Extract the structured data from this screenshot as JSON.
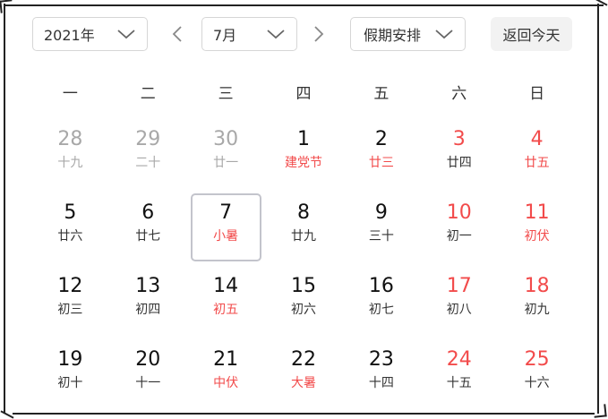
{
  "toolbar": {
    "year_value": "2021年",
    "month_value": "7月",
    "holiday_value": "假期安排",
    "today_label": "返回今天"
  },
  "weekdays": [
    "一",
    "二",
    "三",
    "四",
    "五",
    "六",
    "日"
  ],
  "colors": {
    "accent_red": "#f24b4b",
    "muted": "#a8a8a8",
    "selected_border": "#c3c4cc"
  },
  "icons": {
    "prev": "chevron-left-icon",
    "next": "chevron-right-icon",
    "dropdown": "chevron-down-icon"
  },
  "days": [
    {
      "day": "28",
      "lunar": "十九",
      "other": true
    },
    {
      "day": "29",
      "lunar": "二十",
      "other": true
    },
    {
      "day": "30",
      "lunar": "廿一",
      "other": true
    },
    {
      "day": "1",
      "lunar": "建党节",
      "festival": true
    },
    {
      "day": "2",
      "lunar": "廿三",
      "festival": true
    },
    {
      "day": "3",
      "lunar": "廿四",
      "weekend": true
    },
    {
      "day": "4",
      "lunar": "廿五",
      "weekend": true,
      "festival": true
    },
    {
      "day": "5",
      "lunar": "廿六"
    },
    {
      "day": "6",
      "lunar": "廿七"
    },
    {
      "day": "7",
      "lunar": "小暑",
      "festival": true,
      "selected": true
    },
    {
      "day": "8",
      "lunar": "廿九"
    },
    {
      "day": "9",
      "lunar": "三十"
    },
    {
      "day": "10",
      "lunar": "初一",
      "weekend": true
    },
    {
      "day": "11",
      "lunar": "初伏",
      "weekend": true,
      "festival": true
    },
    {
      "day": "12",
      "lunar": "初三"
    },
    {
      "day": "13",
      "lunar": "初四"
    },
    {
      "day": "14",
      "lunar": "初五",
      "festival": true
    },
    {
      "day": "15",
      "lunar": "初六"
    },
    {
      "day": "16",
      "lunar": "初七"
    },
    {
      "day": "17",
      "lunar": "初八",
      "weekend": true
    },
    {
      "day": "18",
      "lunar": "初九",
      "weekend": true
    },
    {
      "day": "19",
      "lunar": "初十"
    },
    {
      "day": "20",
      "lunar": "十一"
    },
    {
      "day": "21",
      "lunar": "中伏",
      "festival": true
    },
    {
      "day": "22",
      "lunar": "大暑",
      "festival": true
    },
    {
      "day": "23",
      "lunar": "十四"
    },
    {
      "day": "24",
      "lunar": "十五",
      "weekend": true
    },
    {
      "day": "25",
      "lunar": "十六",
      "weekend": true
    }
  ]
}
